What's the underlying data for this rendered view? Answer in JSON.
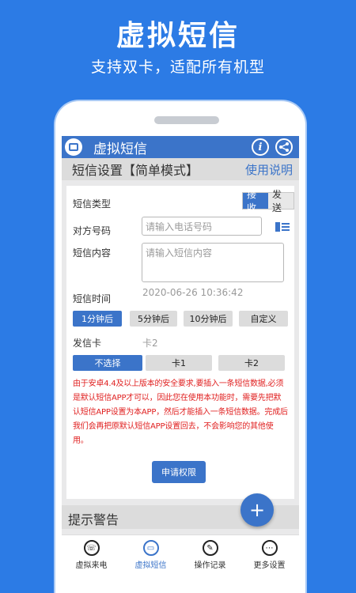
{
  "promo": {
    "title": "虚拟短信",
    "subtitle": "支持双卡，适配所有机型"
  },
  "app": {
    "title": "虚拟短信",
    "info_icon": "i",
    "share_icon": "share-icon"
  },
  "section": {
    "title": "短信设置【简单模式】",
    "help": "使用说明"
  },
  "form": {
    "type_label": "短信类型",
    "type_options": [
      "接收",
      "发送"
    ],
    "type_selected": "接收",
    "number_label": "对方号码",
    "number_placeholder": "请输入电话号码",
    "content_label": "短信内容",
    "content_placeholder": "请输入短信内容",
    "time_label": "短信时间",
    "time_value": "2020-06-26 10:36:42",
    "time_options": [
      "1分钟后",
      "5分钟后",
      "10分钟后",
      "自定义"
    ],
    "time_selected": "1分钟后",
    "card_label": "发信卡",
    "card_value": "卡2",
    "card_options": [
      "不选择",
      "卡1",
      "卡2"
    ],
    "card_selected": "不选择"
  },
  "warning_text": "由于安卓4.4及以上版本的安全要求,要插入一条短信数据,必须是默认短信APP才可以，因此您在使用本功能时，需要先把默认短信APP设置为本APP，然后才能插入一条短信数据。完成后我们会再把原默认短信APP设置回去，不会影响您的其他使用。",
  "grant_button": "申请权限",
  "warn_section": "提示警告",
  "fab": "+",
  "tabs": [
    {
      "label": "虚拟来电",
      "icon": "phone-icon",
      "glyph": "☏"
    },
    {
      "label": "虚拟短信",
      "icon": "message-icon",
      "glyph": "▭"
    },
    {
      "label": "操作记录",
      "icon": "edit-icon",
      "glyph": "✎"
    },
    {
      "label": "更多设置",
      "icon": "more-icon",
      "glyph": "⋯"
    }
  ],
  "active_tab": "虚拟短信",
  "colors": {
    "background": "#2c7be5",
    "accent": "#3b74c9",
    "warning": "#e02020"
  }
}
